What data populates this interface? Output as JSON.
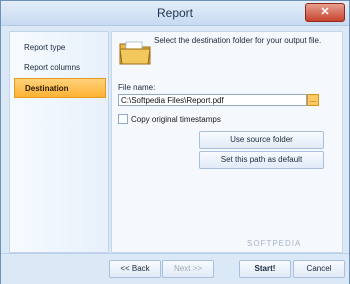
{
  "window": {
    "title": "Report"
  },
  "sidebar": {
    "items": [
      {
        "label": "Report type"
      },
      {
        "label": "Report columns"
      },
      {
        "label": "Destination"
      }
    ]
  },
  "main": {
    "instruction": "Select the destination folder for your output file.",
    "file_name_label": "File name:",
    "file_path": "C:\\Softpedia Files\\Report.pdf",
    "browse_label": "...",
    "copy_timestamps_label": "Copy original timestamps",
    "use_source_label": "Use source folder",
    "set_default_label": "Set this path as default"
  },
  "footer": {
    "back_label": "<< Back",
    "next_label": "Next >>",
    "start_label": "Start!",
    "cancel_label": "Cancel"
  },
  "watermark": "SOFTPEDIA"
}
